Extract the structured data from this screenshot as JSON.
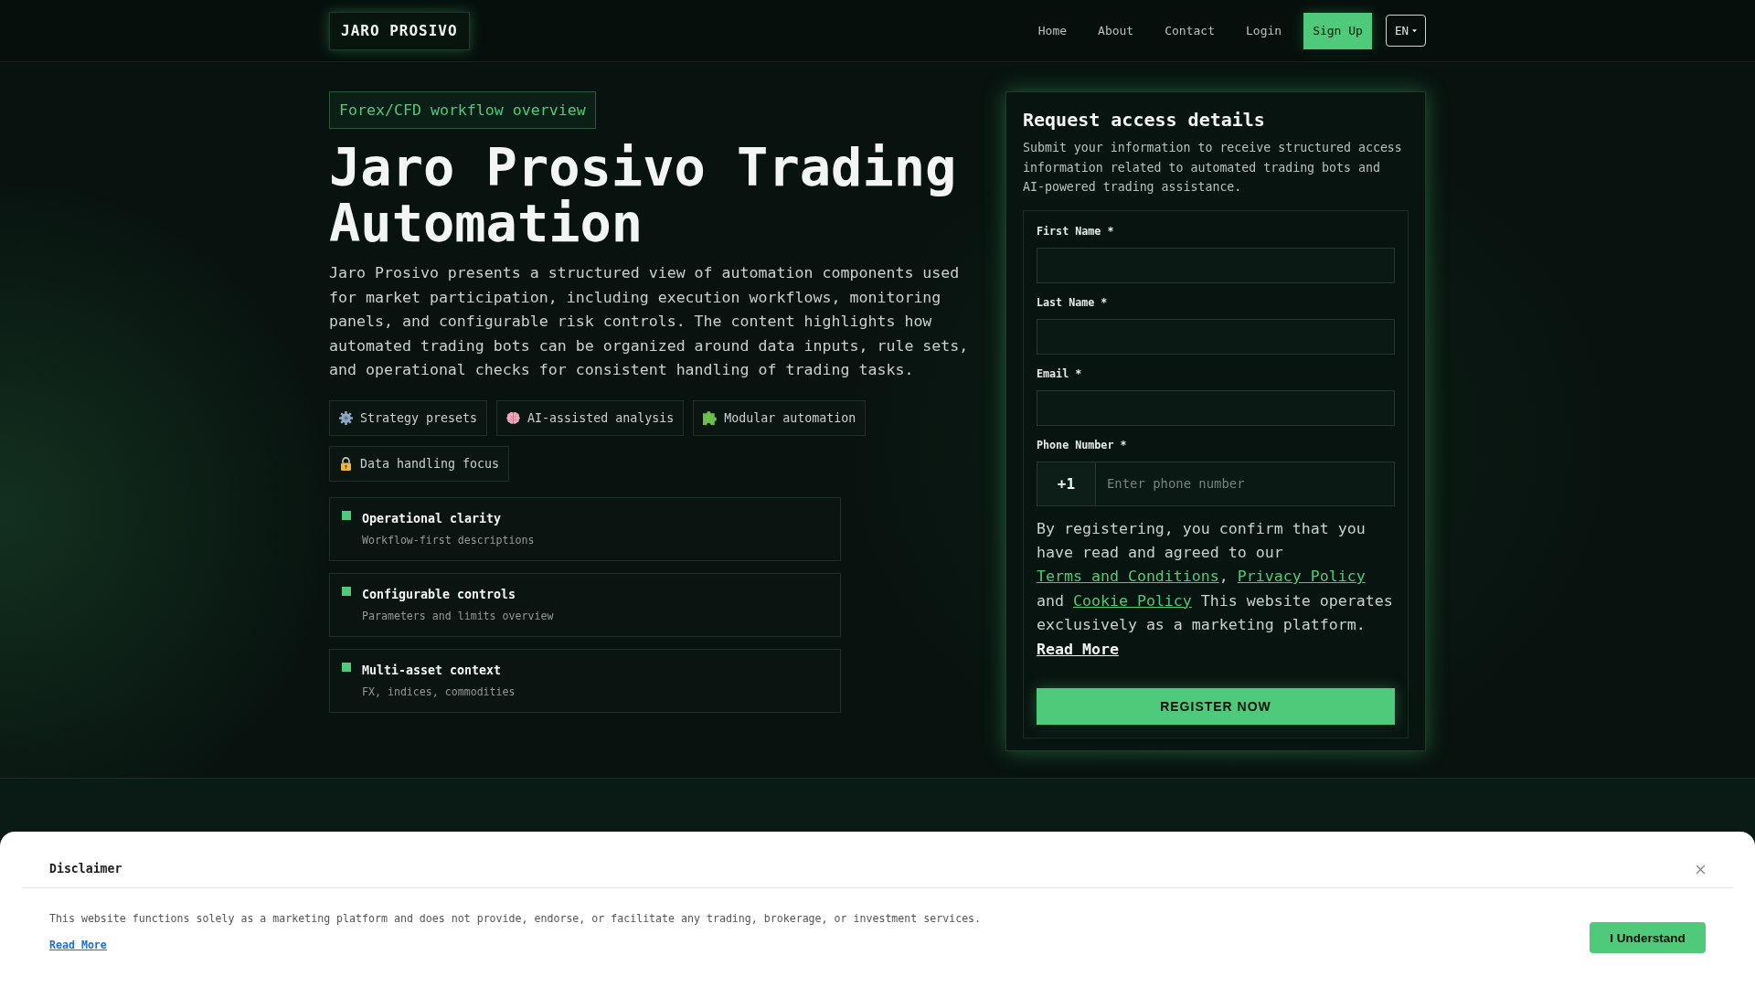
{
  "header": {
    "logo": "JARO PROSIVO",
    "nav": [
      {
        "label": "Home"
      },
      {
        "label": "About"
      },
      {
        "label": "Contact"
      },
      {
        "label": "Login"
      }
    ],
    "signup": "Sign Up",
    "language": "EN"
  },
  "hero": {
    "badge": "Forex/CFD workflow overview",
    "title": "Jaro Prosivo Trading Automation",
    "description": "Jaro Prosivo presents a structured view of automation components used for market participation, including execution workflows, monitoring panels, and configurable risk controls. The content highlights how automated trading bots can be organized around data inputs, rule sets, and operational checks for consistent handling of trading tasks.",
    "chips": [
      {
        "label": "Strategy presets"
      },
      {
        "label": "AI-assisted analysis"
      },
      {
        "label": "Modular automation"
      },
      {
        "label": "Data handling focus"
      }
    ],
    "features": [
      {
        "title": "Operational clarity",
        "subtitle": "Workflow-first descriptions"
      },
      {
        "title": "Configurable controls",
        "subtitle": "Parameters and limits overview"
      },
      {
        "title": "Multi-asset context",
        "subtitle": "FX, indices, commodities"
      }
    ]
  },
  "form": {
    "title": "Request access details",
    "description": "Submit your information to receive structured access information related to automated trading bots and AI-powered trading assistance.",
    "fields": [
      {
        "label": "First Name *"
      },
      {
        "label": "Last Name *"
      },
      {
        "label": "Email *"
      }
    ],
    "phone": {
      "label": "Phone Number *",
      "country_code": "+1",
      "placeholder": "Enter phone number"
    },
    "consent": [
      {
        "kind": "text",
        "text": "By registering, you confirm that you have read and agreed to our "
      },
      {
        "kind": "link",
        "text": "Terms and Conditions"
      },
      {
        "kind": "text",
        "text": ", "
      },
      {
        "kind": "link",
        "text": "Privacy Policy"
      },
      {
        "kind": "text",
        "text": " and "
      },
      {
        "kind": "link",
        "text": "Cookie Policy"
      },
      {
        "kind": "text",
        "text": " This website operates exclusively as a marketing platform. "
      },
      {
        "kind": "more",
        "text": "Read More"
      }
    ],
    "submit": "REGISTER NOW"
  },
  "disclaimer": {
    "title": "Disclaimer",
    "text": "This website functions solely as a marketing platform and does not provide, endorse, or facilitate any trading, brokerage, or investment services.",
    "link": "Read More",
    "button": "I Understand"
  }
}
